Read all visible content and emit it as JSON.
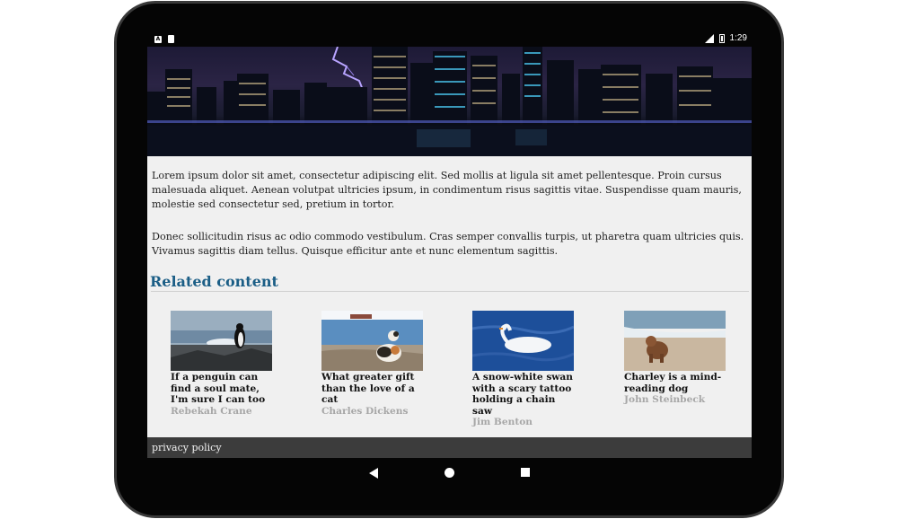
{
  "status_bar": {
    "time": "1:29",
    "left_icons": [
      "a-notification-icon",
      "sd-card-icon"
    ],
    "right_icons": [
      "signal-icon",
      "battery-icon"
    ]
  },
  "article": {
    "paragraphs": [
      "Lorem ipsum dolor sit amet, consectetur adipiscing elit. Sed mollis at ligula sit amet pellentesque. Proin cursus malesuada aliquet. Aenean volutpat ultricies ipsum, in condimentum risus sagittis vitae. Suspendisse quam mauris, molestie sed consectetur sed, pretium in tortor.",
      "Donec sollicitudin risus ac odio commodo vestibulum. Cras semper convallis turpis, ut pharetra quam ultricies quis. Vivamus sagittis diam tellus. Quisque efficitur ante et nunc elementum sagittis."
    ]
  },
  "related": {
    "heading": "Related content",
    "items": [
      {
        "title": "If a penguin can find a soul mate, I'm sure I can too",
        "author": "Rebekah Crane"
      },
      {
        "title": "What greater gift than the love of a cat",
        "author": "Charles Dickens"
      },
      {
        "title": "A snow-white swan with a scary tattoo holding a chain saw",
        "author": "Jim Benton"
      },
      {
        "title": "Charley is a mind-reading dog",
        "author": "John Steinbeck"
      }
    ]
  },
  "footer": {
    "privacy_label": "privacy policy"
  },
  "colors": {
    "heading": "#1b5e86",
    "footer_bg": "#3c3c3c",
    "page_bg": "#f0f0f0",
    "author_gray": "#a7a7a7"
  }
}
